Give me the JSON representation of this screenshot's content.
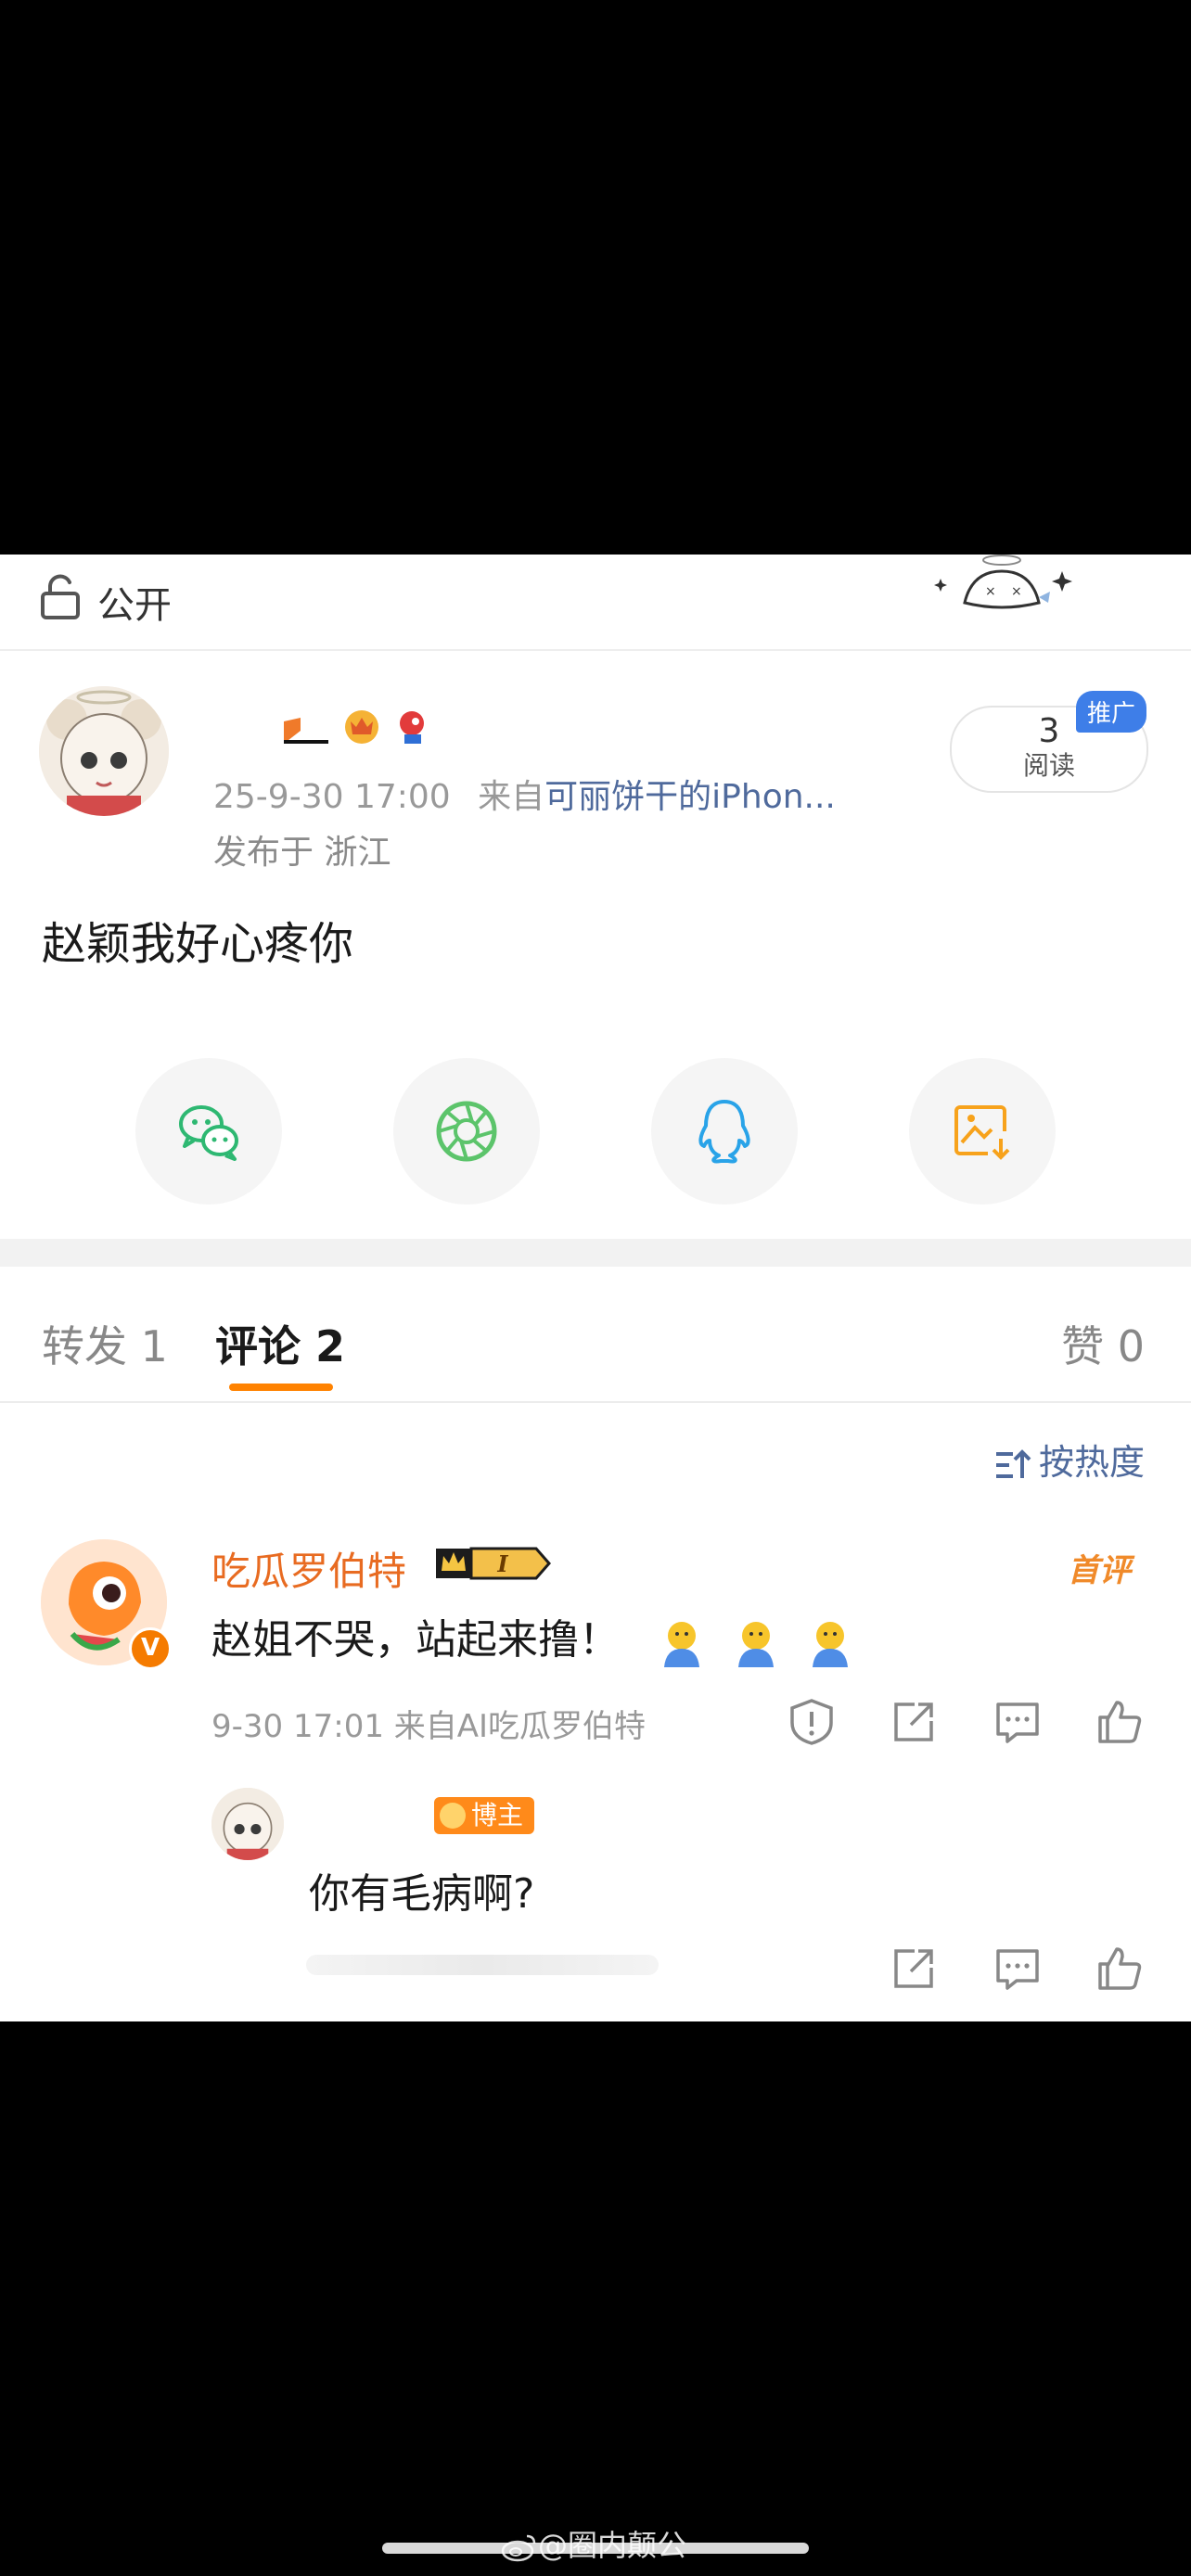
{
  "visibility": {
    "label": "公开"
  },
  "post": {
    "meta_time": "25-9-30 17:00",
    "meta_from_prefix": "来自",
    "meta_source": "可丽饼干的iPhon...",
    "location": "发布于 浙江",
    "text": "赵颖我好心疼你",
    "read_count": "3",
    "read_label": "阅读",
    "promo_tag": "推广"
  },
  "share": {
    "icons": [
      "wechat-icon",
      "moments-icon",
      "qq-icon",
      "save-image-icon"
    ]
  },
  "tabs": {
    "repost": "转发 1",
    "comment": "评论 2",
    "like": "赞 0"
  },
  "sort": {
    "label": "按热度"
  },
  "comment": {
    "author": "吃瓜罗伯特",
    "level_badge": "I",
    "first_tag": "首评",
    "text": "赵姐不哭，站起来撸！",
    "meta": "9-30 17:01 来自AI吃瓜罗伯特"
  },
  "reply": {
    "role_tag": "博主",
    "text": "你有毛病啊?"
  },
  "watermark": "@圈内颠公",
  "colors": {
    "accent": "#ff8200",
    "link": "#4f6a9c",
    "promo": "#3e7ee8",
    "name": "#e86b21"
  }
}
